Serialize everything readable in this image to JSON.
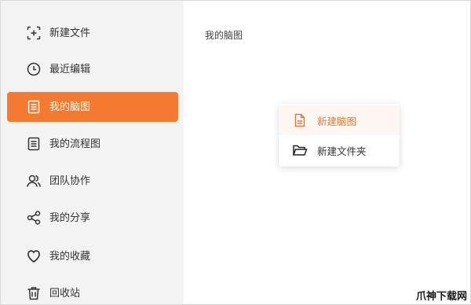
{
  "sidebar": {
    "items": [
      {
        "label": "新建文件",
        "icon": "new-file-icon"
      },
      {
        "label": "最近编辑",
        "icon": "clock-icon"
      },
      {
        "label": "我的脑图",
        "icon": "document-icon",
        "active": true
      },
      {
        "label": "我的流程图",
        "icon": "document-icon"
      },
      {
        "label": "团队协作",
        "icon": "users-icon"
      },
      {
        "label": "我的分享",
        "icon": "share-icon"
      },
      {
        "label": "我的收藏",
        "icon": "heart-icon"
      },
      {
        "label": "回收站",
        "icon": "trash-icon"
      }
    ]
  },
  "main": {
    "title": "我的脑图"
  },
  "popup": {
    "items": [
      {
        "label": "新建脑图",
        "icon": "file-icon"
      },
      {
        "label": "新建文件夹",
        "icon": "folder-icon"
      }
    ]
  },
  "watermark": "爪神下载网",
  "colors": {
    "accent": "#f47a32",
    "sidebar_bg": "#f3f3f3",
    "popup_highlight_text": "#e07a3c"
  }
}
